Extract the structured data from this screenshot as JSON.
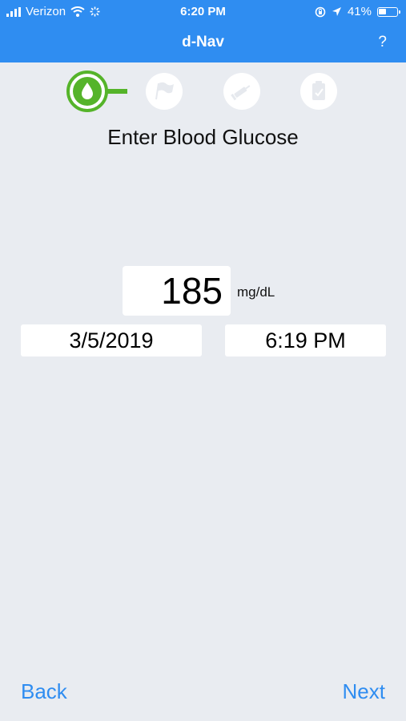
{
  "status_bar": {
    "carrier": "Verizon",
    "time": "6:20 PM",
    "battery": "41%",
    "battery_level": 0.41
  },
  "nav": {
    "title": "d-Nav",
    "help": "?"
  },
  "steps": {
    "active_index": 0,
    "items": [
      "blood-drop-icon",
      "flag-icon",
      "syringe-icon",
      "clipboard-icon"
    ]
  },
  "heading": "Enter Blood Glucose",
  "glucose": {
    "value": "185",
    "unit": "mg/dL"
  },
  "date": "3/5/2019",
  "time": "6:19 PM",
  "buttons": {
    "back": "Back",
    "next": "Next"
  },
  "colors": {
    "primary": "#2f8df1",
    "step_active": "#55b42a",
    "background": "#e9ecf1"
  }
}
